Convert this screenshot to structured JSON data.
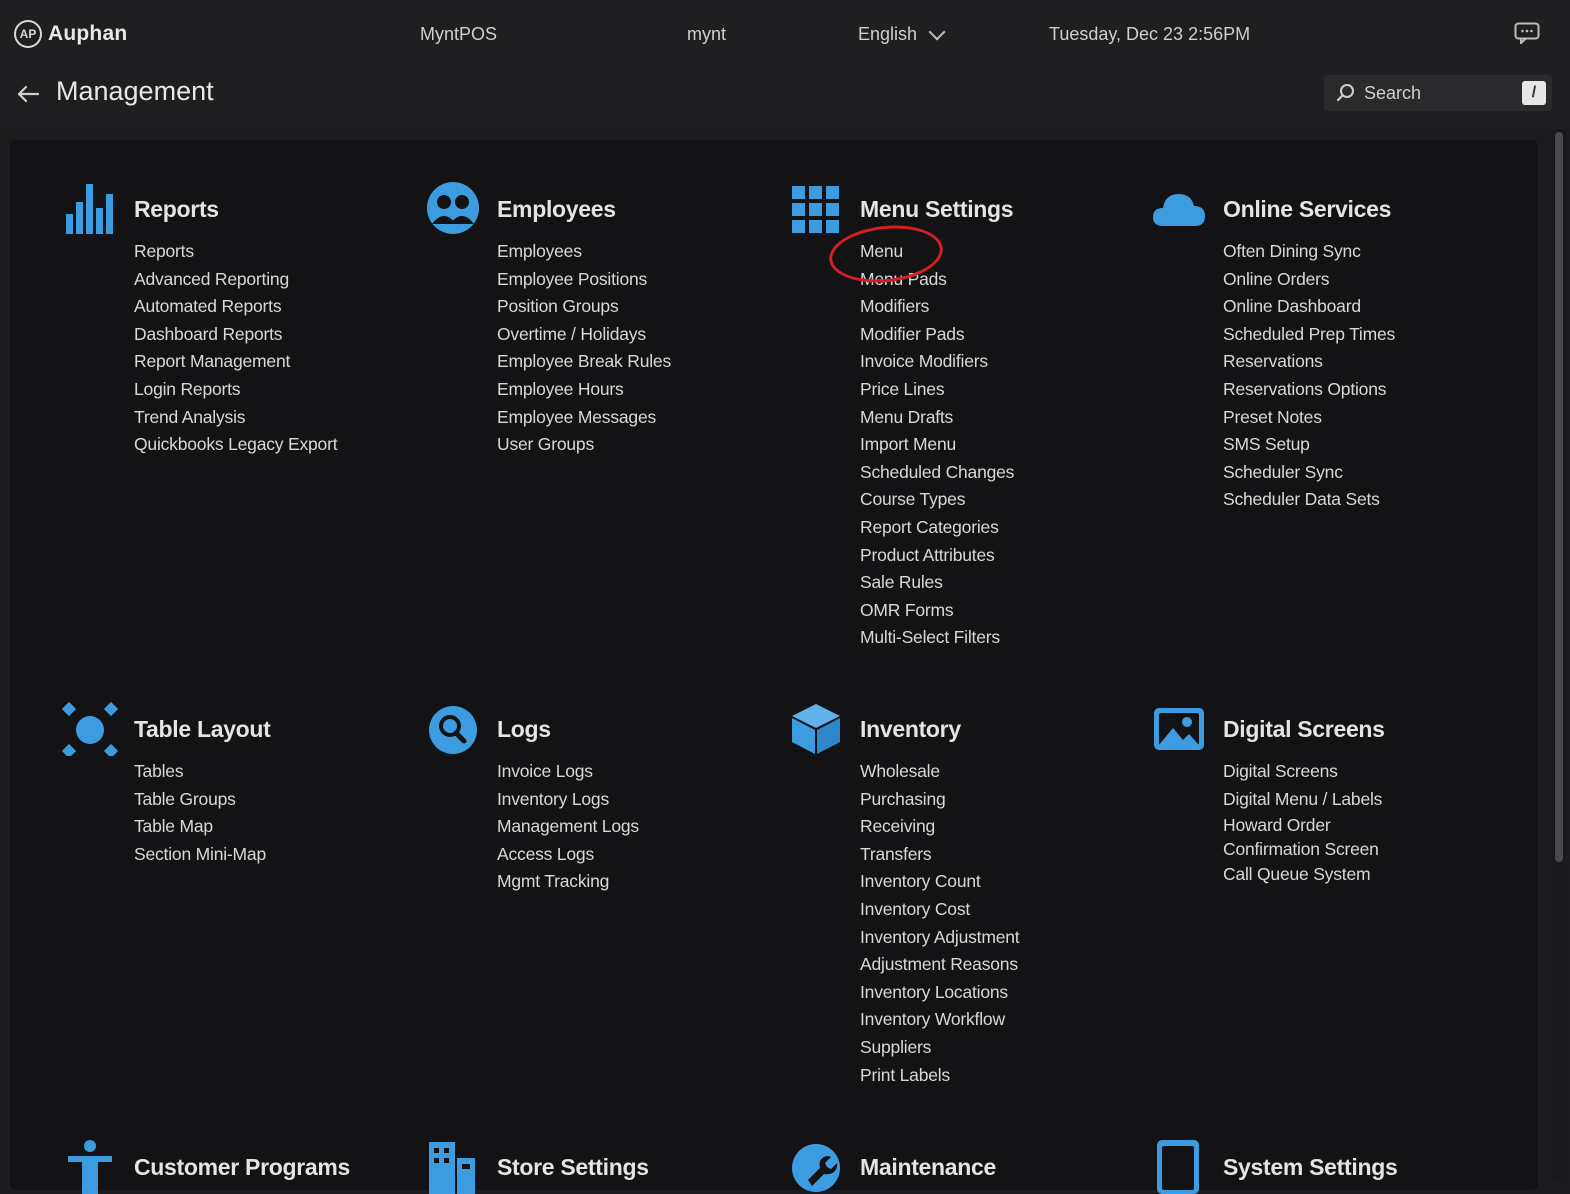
{
  "topbar": {
    "logo_mark": "AP",
    "logo_text": "Auphan",
    "store": "MyntPOS",
    "user": "mynt",
    "language": "English",
    "datetime": "Tuesday, Dec 23 2:56PM"
  },
  "header": {
    "title": "Management",
    "search_label": "Search",
    "search_shortcut": "/"
  },
  "colors": {
    "accent": "#3d9be0",
    "highlight": "#d42020"
  },
  "sections": [
    {
      "title": "Reports",
      "icon": "bar-chart-icon",
      "items": [
        "Reports",
        "Advanced Reporting",
        "Automated Reports",
        "Dashboard Reports",
        "Report Management",
        "Login Reports",
        "Trend Analysis",
        "Quickbooks Legacy Export"
      ]
    },
    {
      "title": "Employees",
      "icon": "employees-icon",
      "items": [
        "Employees",
        "Employee Positions",
        "Position Groups",
        "Overtime / Holidays",
        "Employee Break Rules",
        "Employee Hours",
        "Employee Messages",
        "User Groups"
      ]
    },
    {
      "title": "Menu Settings",
      "icon": "grid-icon",
      "items": [
        "Menu",
        "Menu Pads",
        "Modifiers",
        "Modifier Pads",
        "Invoice Modifiers",
        "Price Lines",
        "Menu Drafts",
        "Import Menu",
        "Scheduled Changes",
        "Course Types",
        "Report Categories",
        "Product Attributes",
        "Sale Rules",
        "OMR Forms",
        "Multi-Select Filters"
      ]
    },
    {
      "title": "Online Services",
      "icon": "cloud-icon",
      "items": [
        "Often Dining Sync",
        "Online Orders",
        "Online Dashboard",
        "Scheduled Prep Times",
        "Reservations",
        "Reservations Options",
        "Preset Notes",
        "SMS Setup",
        "Scheduler Sync",
        "Scheduler Data Sets"
      ]
    },
    {
      "title": "Table Layout",
      "icon": "table-layout-icon",
      "items": [
        "Tables",
        "Table Groups",
        "Table Map",
        "Section Mini-Map"
      ]
    },
    {
      "title": "Logs",
      "icon": "magnifier-icon",
      "items": [
        "Invoice Logs",
        "Inventory Logs",
        "Management Logs",
        "Access Logs",
        "Mgmt Tracking"
      ]
    },
    {
      "title": "Inventory",
      "icon": "box-icon",
      "items": [
        "Wholesale",
        "Purchasing",
        "Receiving",
        "Transfers",
        "Inventory Count",
        "Inventory Cost",
        "Inventory Adjustment",
        "Adjustment Reasons",
        "Inventory Locations",
        "Inventory Workflow",
        "Suppliers",
        "Print Labels"
      ]
    },
    {
      "title": "Digital Screens",
      "icon": "picture-icon",
      "items": [
        "Digital Screens",
        "Digital Menu / Labels",
        "Howard Order Confirmation Screen",
        "Call Queue System"
      ]
    },
    {
      "title": "Customer Programs",
      "icon": "person-icon",
      "items": []
    },
    {
      "title": "Store Settings",
      "icon": "building-icon",
      "items": []
    },
    {
      "title": "Maintenance",
      "icon": "wrench-icon",
      "items": []
    },
    {
      "title": "System Settings",
      "icon": "tablet-icon",
      "items": []
    }
  ]
}
